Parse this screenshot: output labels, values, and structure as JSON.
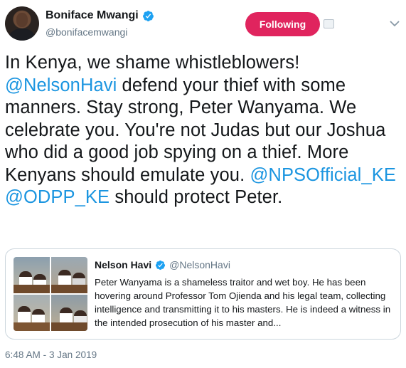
{
  "author": {
    "name": "Boniface Mwangi",
    "handle": "@bonifacemwangi",
    "verified": true
  },
  "follow_button": {
    "label": "Following",
    "color": "#e0245e"
  },
  "tweet": {
    "line1": "In Kenya, we shame whistleblowers!",
    "mention1": "@NelsonHavi",
    "text2": " defend your thief with some manners. Stay strong, Peter Wanyama. We celebrate you. You're not Judas but our Joshua who did a good job spying on a thief. More Kenyans should emulate you. ",
    "mention2": "@NPSOfficial_KE",
    "space": " ",
    "mention3": "@ODPP_KE",
    "text3": " should protect Peter."
  },
  "quote": {
    "name": "Nelson Havi",
    "handle": "@NelsonHavi",
    "verified": true,
    "text": "Peter Wanyama is a shameless traitor and wet boy. He has been hovering around Professor Tom Ojienda and his legal team, collecting intelligence and transmitting it to his masters. He is indeed a witness in the intended prosecution of his master and..."
  },
  "timestamp": "6:48 AM - 3 Jan 2019",
  "colors": {
    "accent": "#1b95e0",
    "verified": "#1da1f2",
    "text": "#14171a",
    "secondary": "#657786"
  },
  "icons": {
    "verified": "verified-badge-icon",
    "chevron": "chevron-down-icon"
  }
}
